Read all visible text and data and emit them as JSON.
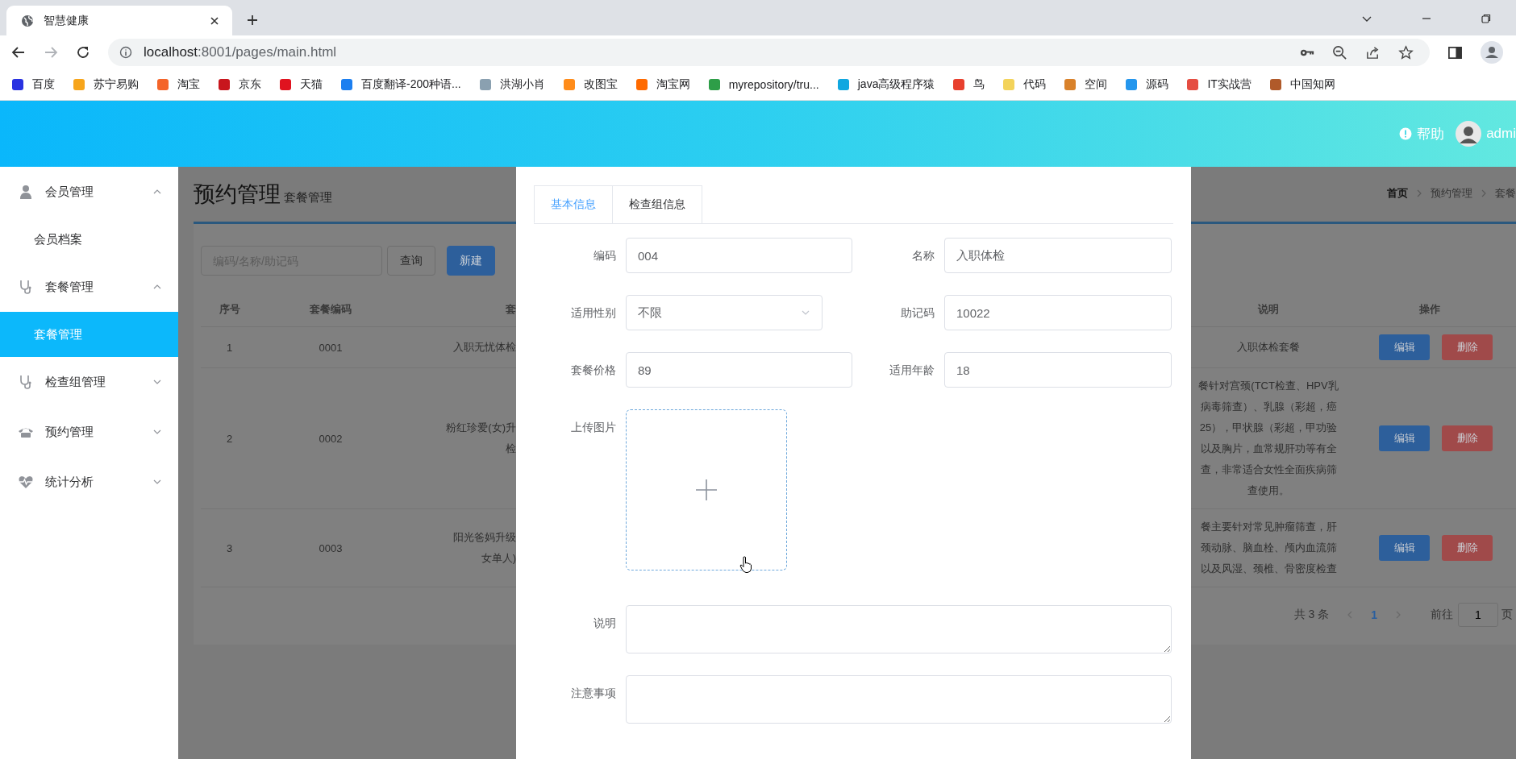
{
  "browser": {
    "tab_title": "智慧健康",
    "url_host": "localhost",
    "url_path": ":8001/pages/main.html",
    "bookmarks": [
      {
        "label": "百度"
      },
      {
        "label": "苏宁易购"
      },
      {
        "label": "淘宝"
      },
      {
        "label": "京东"
      },
      {
        "label": "天猫"
      },
      {
        "label": "百度翻译-200种语..."
      },
      {
        "label": "洪湖小肖"
      },
      {
        "label": "改图宝"
      },
      {
        "label": "淘宝网"
      },
      {
        "label": "myrepository/tru..."
      },
      {
        "label": "java高级程序猿"
      },
      {
        "label": "鸟"
      },
      {
        "label": "代码"
      },
      {
        "label": "空间"
      },
      {
        "label": "源码"
      },
      {
        "label": "IT实战营"
      },
      {
        "label": "中国知网"
      }
    ]
  },
  "header": {
    "help": "帮助",
    "user": "admi"
  },
  "sidebar": {
    "items": [
      {
        "label": "会员管理",
        "expanded": true,
        "children": [
          {
            "label": "会员档案",
            "selected": false
          }
        ]
      },
      {
        "label": "套餐管理",
        "expanded": true,
        "children": [
          {
            "label": "套餐管理",
            "selected": true
          }
        ]
      },
      {
        "label": "检查组管理",
        "expanded": false
      },
      {
        "label": "预约管理",
        "expanded": false
      },
      {
        "label": "统计分析",
        "expanded": false
      }
    ]
  },
  "page": {
    "title": "预约管理",
    "subtitle": "套餐管理",
    "breadcrumb": [
      "首页",
      "预约管理",
      "套餐"
    ]
  },
  "toolbar": {
    "search_placeholder": "编码/名称/助记码",
    "buttons": [
      {
        "label": "查询",
        "kind": "default"
      },
      {
        "label": "新建",
        "kind": "primary"
      }
    ]
  },
  "table": {
    "columns": [
      "序号",
      "套餐编码",
      "套",
      "说明",
      "操作"
    ],
    "rows": [
      {
        "seq": "1",
        "code": "0001",
        "name": [
          "入职无忧体检"
        ],
        "description": [
          "入职体检套餐"
        ],
        "actions": [
          {
            "label": "编辑",
            "kind": "edit"
          },
          {
            "label": "删除",
            "kind": "delete"
          }
        ]
      },
      {
        "seq": "2",
        "code": "0002",
        "name": [
          "粉红珍爱(女)升",
          "检"
        ],
        "description": [
          "餐针对宫颈(TCT检查、HPV乳",
          "病毒筛查）、乳腺（彩超，癌",
          "25），甲状腺（彩超，甲功验",
          "以及胸片，血常规肝功等有全",
          "查，非常适合女性全面疾病筛",
          "查使用。"
        ],
        "actions": [
          {
            "label": "编辑",
            "kind": "edit"
          },
          {
            "label": "删除",
            "kind": "delete"
          }
        ]
      },
      {
        "seq": "3",
        "code": "0003",
        "name": [
          "阳光爸妈升级",
          "女单人)"
        ],
        "description": [
          "餐主要针对常见肿瘤筛查，肝",
          "颈动脉、脑血栓、颅内血流筛",
          "以及风湿、颈椎、骨密度检查"
        ],
        "actions": [
          {
            "label": "编辑",
            "kind": "edit"
          },
          {
            "label": "删除",
            "kind": "delete"
          }
        ]
      }
    ]
  },
  "pagination": {
    "total": "共 3 条",
    "pages": [
      {
        "label": "1",
        "selected": true
      }
    ],
    "goto_label": "前往",
    "goto_value": "1",
    "goto_suffix": "页"
  },
  "dialog": {
    "tabs": [
      {
        "label": "基本信息",
        "selected": true
      },
      {
        "label": "检查组信息",
        "selected": false
      }
    ],
    "rows": [
      [
        {
          "label": "编码",
          "kind": "text",
          "value": "004"
        },
        {
          "label": "名称",
          "kind": "text",
          "value": "入职体检"
        }
      ],
      [
        {
          "label": "适用性别",
          "kind": "select",
          "value": "不限"
        },
        {
          "label": "助记码",
          "kind": "text",
          "value": "10022"
        }
      ],
      [
        {
          "label": "套餐价格",
          "kind": "text",
          "value": "89"
        },
        {
          "label": "适用年龄",
          "kind": "text",
          "value": "18"
        }
      ],
      [
        {
          "label": "上传图片",
          "kind": "upload"
        }
      ],
      [
        {
          "label": "说明",
          "kind": "textarea"
        }
      ],
      [
        {
          "label": "注意事项",
          "kind": "textarea"
        }
      ]
    ]
  }
}
